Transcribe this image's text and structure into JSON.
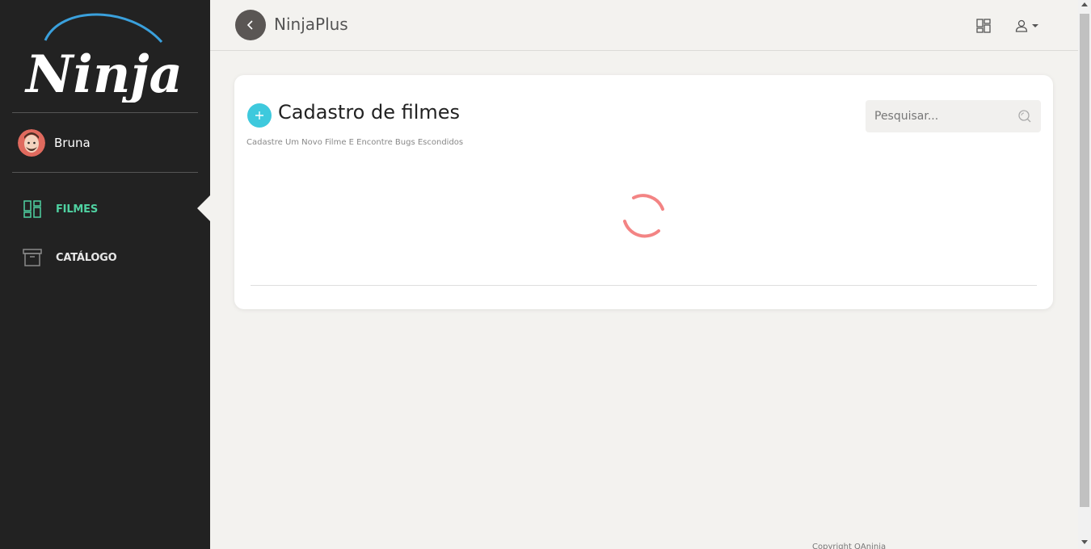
{
  "app": {
    "title": "NinjaPlus",
    "logo_text": "Ninja+"
  },
  "colors": {
    "sidebar_bg": "#222222",
    "accent_green": "#4fd1a1",
    "add_button": "#3ec9dd",
    "spinner": "#f38484",
    "logo_arc": "#3aa0dc"
  },
  "sidebar": {
    "user": {
      "name": "Bruna",
      "avatar_icon": "user-avatar"
    },
    "items": [
      {
        "label": "FILMES",
        "icon": "dashboard-icon",
        "active": true
      },
      {
        "label": "CATÁLOGO",
        "icon": "archive-icon",
        "active": false
      }
    ]
  },
  "topbar": {
    "back_icon": "chevron-left-icon",
    "grid_icon": "dashboard-icon",
    "user_icon": "user-icon"
  },
  "card": {
    "title": "Cadastro de filmes",
    "subtitle": "Cadastre Um Novo Filme E Encontre Bugs Escondidos",
    "search": {
      "placeholder": "Pesquisar...",
      "value": ""
    },
    "loading": true
  },
  "footer": {
    "text": "Copyright QAninja"
  }
}
